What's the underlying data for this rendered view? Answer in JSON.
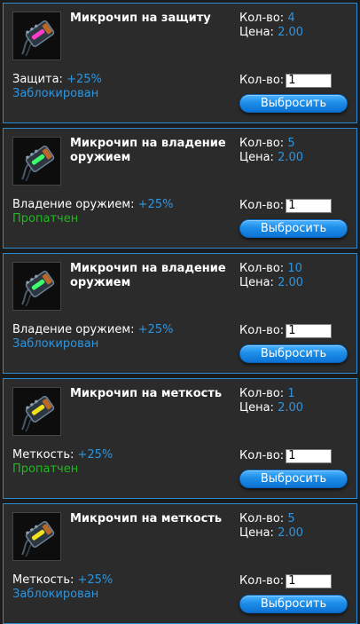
{
  "labels": {
    "count": "Кол-во:",
    "price": "Цена:",
    "qty": "Кол-во:",
    "drop": "Выбросить"
  },
  "items": [
    {
      "title": "Микрочип на защиту",
      "icon": "microchip-pink-icon",
      "glow": "#ff3cc8",
      "count": "4",
      "price": "2.00",
      "stat_label": "Защита:",
      "stat_value": "+25%",
      "status": "Заблокирован",
      "status_type": "blocked",
      "qty": "1"
    },
    {
      "title": "Микрочип на владение оружием",
      "icon": "microchip-green-icon",
      "glow": "#3cff6a",
      "count": "5",
      "price": "2.00",
      "stat_label": "Владение оружием:",
      "stat_value": "+25%",
      "status": "Пропатчен",
      "status_type": "patched",
      "qty": "1"
    },
    {
      "title": "Микрочип на владение оружием",
      "icon": "microchip-green-icon",
      "glow": "#3cff6a",
      "count": "10",
      "price": "2.00",
      "stat_label": "Владение оружием:",
      "stat_value": "+25%",
      "status": "Заблокирован",
      "status_type": "blocked",
      "qty": "1"
    },
    {
      "title": "Микрочип на меткость",
      "icon": "microchip-yellow-icon",
      "glow": "#f2e21a",
      "count": "1",
      "price": "2.00",
      "stat_label": "Меткость:",
      "stat_value": "+25%",
      "status": "Пропатчен",
      "status_type": "patched",
      "qty": "1"
    },
    {
      "title": "Микрочип на меткость",
      "icon": "microchip-yellow-icon",
      "glow": "#f2e21a",
      "count": "5",
      "price": "2.00",
      "stat_label": "Меткость:",
      "stat_value": "+25%",
      "status": "Заблокирован",
      "status_type": "blocked",
      "qty": "1"
    }
  ],
  "colors": {
    "border": "#2a8bd0",
    "value": "#2d95e0",
    "patched": "#1fb81f",
    "button": "#1d8ee8"
  }
}
